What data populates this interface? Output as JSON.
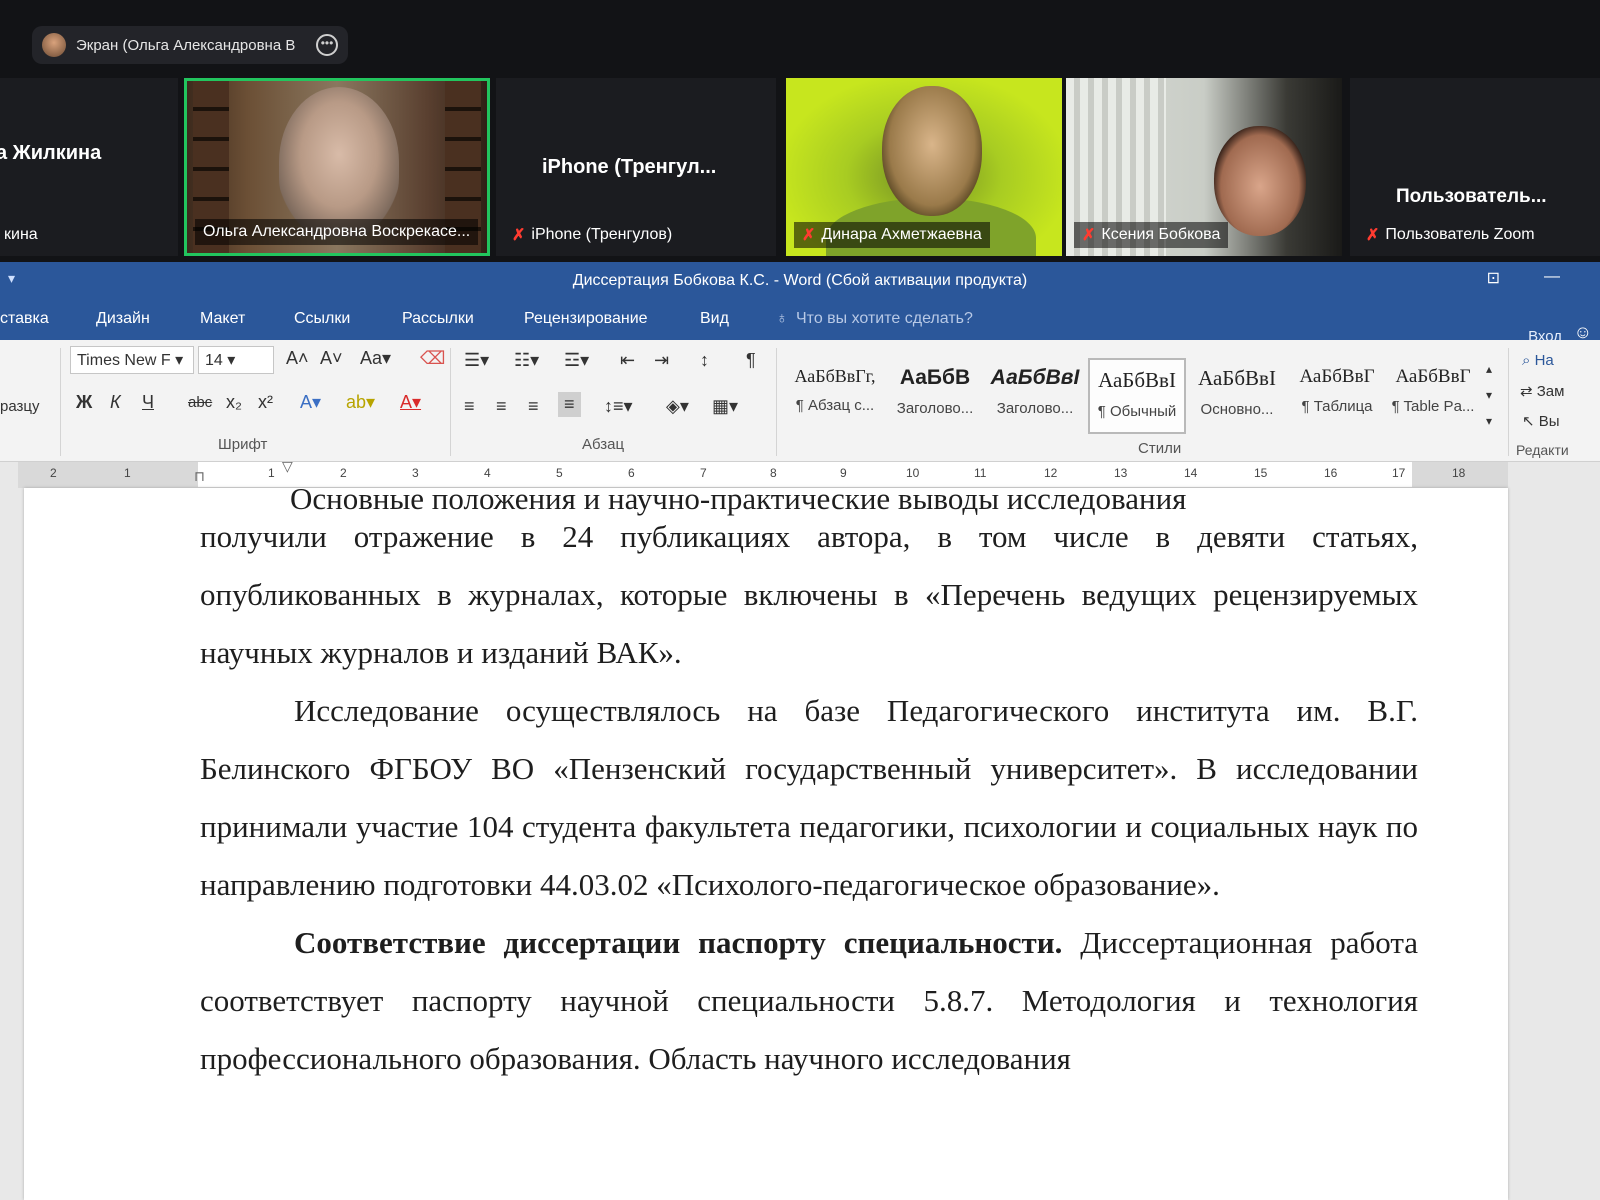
{
  "zoom": {
    "share_label": "Экран (Ольга Александровна В",
    "tiles": [
      {
        "big_name": "а Жилкина",
        "label": "кина"
      },
      {
        "label": "Ольга Александровна Воскрекасе..."
      },
      {
        "big_name": "iPhone  (Тренгул...",
        "label": "iPhone (Тренгулов)"
      },
      {
        "label": "Динара Ахметжаевна"
      },
      {
        "label": "Ксения Бобкова"
      },
      {
        "big_name": "Пользователь...",
        "label": "Пользователь Zoom"
      }
    ]
  },
  "word": {
    "title": "Диссертация Бобкова К.С. - Word (Сбой активации продукта)",
    "tabs": [
      "ставка",
      "Дизайн",
      "Макет",
      "Ссылки",
      "Рассылки",
      "Рецензирование",
      "Вид"
    ],
    "tell_me": "Что вы хотите сделать?",
    "login": "Вход",
    "ribbon": {
      "clipboard_label": "разцу",
      "font_name": "Times New F",
      "font_size": "14",
      "font_group": "Шрифт",
      "paragraph_group": "Абзац",
      "styles_group": "Стили",
      "editing_group": "Редакти",
      "editing_items": [
        "На",
        "Зам",
        "Вы"
      ],
      "format_buttons": {
        "bold": "Ж",
        "italic": "К",
        "underline": "Ч",
        "strike": "abc",
        "sub": "x₂",
        "sup": "x²",
        "case": "Aa"
      },
      "styles": [
        {
          "preview": "АаБбВвГг,",
          "name": "¶ Абзац с..."
        },
        {
          "preview": "АаБбВ",
          "name": "Заголово..."
        },
        {
          "preview": "АаБбВвI",
          "name": "Заголово..."
        },
        {
          "preview": "АаБбВвI",
          "name": "¶ Обычный"
        },
        {
          "preview": "АаБбВвI",
          "name": "Основно..."
        },
        {
          "preview": "АаБбВвГ",
          "name": "¶ Таблица"
        },
        {
          "preview": "АаБбВвГ",
          "name": "¶ Table Pa..."
        }
      ]
    },
    "ruler": [
      "2",
      "1",
      "1",
      "2",
      "3",
      "4",
      "5",
      "6",
      "7",
      "8",
      "9",
      "10",
      "11",
      "12",
      "13",
      "14",
      "15",
      "16",
      "17",
      "18"
    ],
    "document": {
      "cut_line": "Основные   положения   и   научно-практические   выводы   исследования",
      "p1": "получили отражение в 24 публикациях автора, в том числе в девяти статьях, опубликованных в журналах, которые включены в «Перечень ведущих рецензируемых научных журналов и изданий ВАК».",
      "p2": "Исследование осуществлялось на базе Педагогического института им. В.Г. Белинского ФГБОУ ВО «Пензенский государственный университет». В исследовании принимали участие 104 студента факультета педагогики, психологии и социальных наук по направлению подготовки 44.03.02 «Психолого-педагогическое образование».",
      "p3_bold": "Соответствие диссертации паспорту специальности.",
      "p3_rest": " Диссертационная работа соответствует паспорту научной специальности 5.8.7. Методология и технология профессионального образования. Область научного исследования"
    }
  }
}
